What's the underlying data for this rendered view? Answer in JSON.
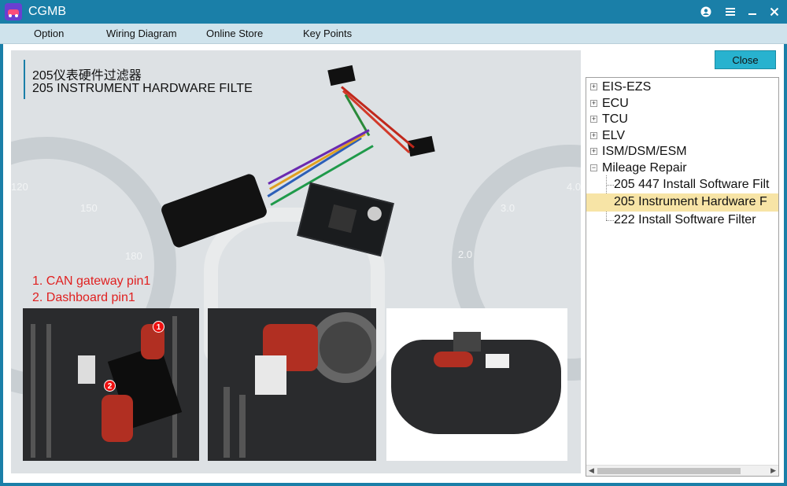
{
  "window": {
    "title": "CGMB"
  },
  "menu": {
    "items": [
      {
        "label": "Option"
      },
      {
        "label": "Wiring Diagram"
      },
      {
        "label": "Online Store"
      },
      {
        "label": "Key Points"
      }
    ]
  },
  "close_button": {
    "label": "Close"
  },
  "diagram": {
    "title_cn": "205仪表硬件过滤器",
    "title_en": "205 INSTRUMENT HARDWARE FILTE",
    "steps": [
      "1. CAN gateway pin1",
      "2. Dashboard pin1"
    ],
    "badges": [
      "1",
      "2"
    ],
    "bg_gauge_numbers": [
      "120",
      "150",
      "180",
      "4.0",
      "3.0",
      "2.0"
    ]
  },
  "tree": {
    "items": [
      {
        "label": "EIS-EZS",
        "expander": "+"
      },
      {
        "label": "ECU",
        "expander": "+"
      },
      {
        "label": "TCU",
        "expander": "+"
      },
      {
        "label": "ELV",
        "expander": "+"
      },
      {
        "label": "ISM/DSM/ESM",
        "expander": "+"
      },
      {
        "label": "Mileage Repair",
        "expander": "−"
      }
    ],
    "children": [
      {
        "label": "205 447 Install Software Filt"
      },
      {
        "label": "205 Instrument Hardware F"
      },
      {
        "label": "222 Install Software Filter"
      }
    ],
    "selected_child": "205 Instrument Hardware F"
  },
  "colors": {
    "titlebar": "#1a7fa8",
    "menubar": "#cfe3ec",
    "close_button": "#28b2cf",
    "selection": "#f7e4a6",
    "step_text": "#e02020"
  },
  "icons": {
    "user": "user-icon",
    "menu": "hamburger-icon",
    "minimize": "minimize-icon",
    "close": "close-icon"
  }
}
